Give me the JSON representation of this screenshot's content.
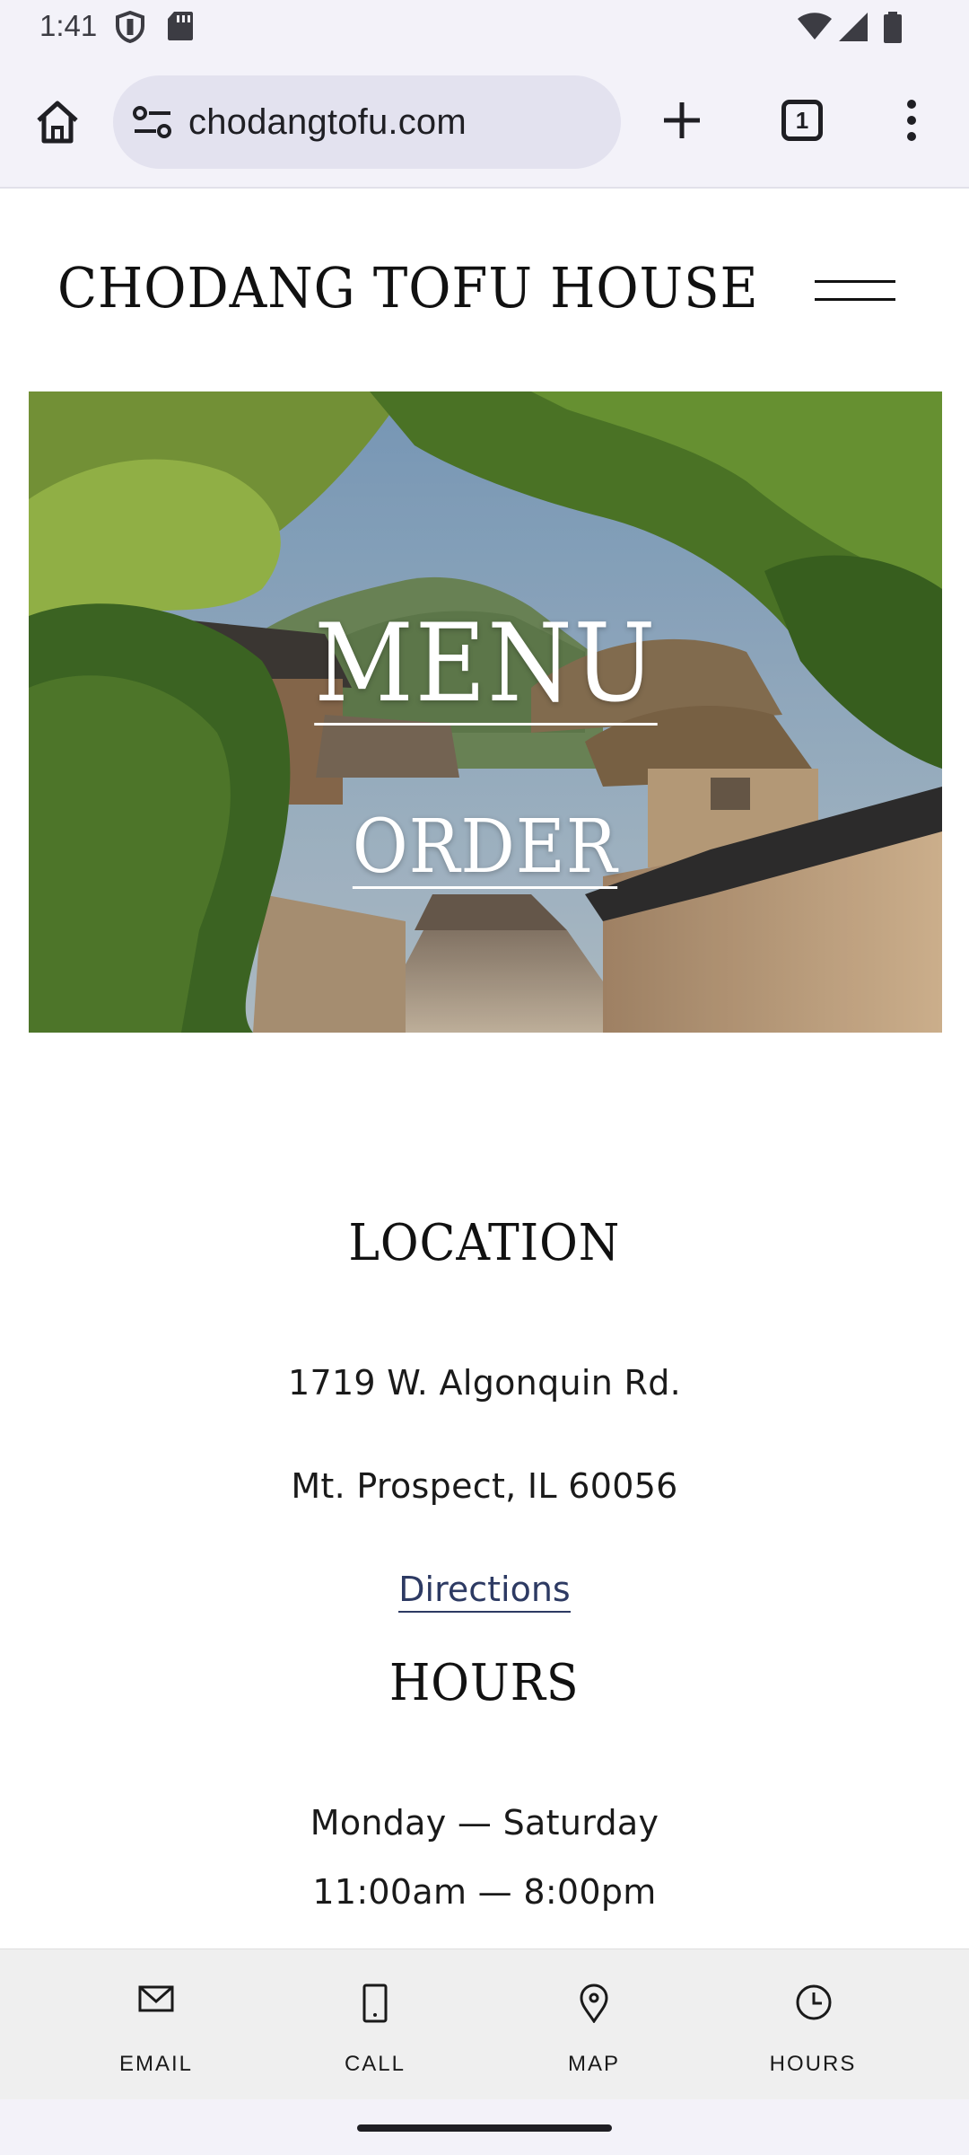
{
  "status_bar": {
    "time": "1:41",
    "icons": [
      "shield-icon",
      "sd-card-icon",
      "wifi-icon",
      "cell-signal-icon",
      "battery-icon"
    ]
  },
  "browser": {
    "url": "chodangtofu.com",
    "tab_count": "1",
    "icons": [
      "home-icon",
      "site-info-icon",
      "plus-icon",
      "tabs-icon",
      "more-vert-icon"
    ]
  },
  "site": {
    "title": "CHODANG TOFU HOUSE",
    "menu_icon": "hamburger-icon"
  },
  "hero": {
    "menu_label": "MENU",
    "order_label": "ORDER"
  },
  "location": {
    "heading": "LOCATION",
    "address_line1": "1719 W. Algonquin Rd.",
    "address_line2": "Mt. Prospect, IL 60056",
    "directions_label": "Directions"
  },
  "hours": {
    "heading": "HOURS",
    "days": "Monday — Saturday",
    "time": "11:00am — 8:00pm"
  },
  "contact_bar": {
    "items": [
      {
        "label": "EMAIL",
        "icon": "mail-icon"
      },
      {
        "label": "CALL",
        "icon": "phone-icon"
      },
      {
        "label": "MAP",
        "icon": "map-pin-icon"
      },
      {
        "label": "HOURS",
        "icon": "clock-icon"
      }
    ]
  },
  "colors": {
    "chrome_background": "#f3f2f9",
    "url_pill": "#e3e2ef",
    "link": "#2d3a63",
    "contact_bar": "#efefef"
  }
}
